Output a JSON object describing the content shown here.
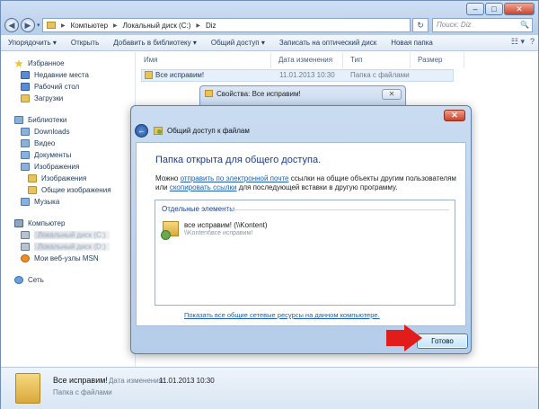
{
  "window": {
    "min_glyph": "–",
    "max_glyph": "□",
    "close_glyph": "✕"
  },
  "address_bar": {
    "crumbs": [
      "Компьютер",
      "Локальный диск (C:)",
      "Diz"
    ],
    "refresh_glyph": "↻"
  },
  "search": {
    "placeholder": "Поиск: Diz",
    "icon_glyph": "🔍"
  },
  "toolbar": {
    "organize": "Упорядочить ▾",
    "open": "Открыть",
    "add_to_library": "Добавить в библиотеку ▾",
    "share": "Общий доступ ▾",
    "burn": "Записать на оптический диск",
    "new_folder": "Новая папка",
    "view_glyph": "☷ ▾",
    "help_glyph": "?"
  },
  "sidebar": {
    "favorites": "Избранное",
    "recent": "Недавние места",
    "desktop": "Рабочий стол",
    "downloads": "Загрузки",
    "libraries": "Библиотеки",
    "lib_downloads": "Downloads",
    "video": "Видео",
    "documents": "Документы",
    "images": "Изображения",
    "images_sub": "Изображения",
    "public_images": "Общие изображения",
    "music": "Музыка",
    "computer": "Компьютер",
    "drive_c": "Локальный диск (C:)",
    "drive_d": "Локальный диск (D:)",
    "msn": "Мои веб-узлы MSN",
    "network": "Сеть"
  },
  "file_list": {
    "columns": [
      "Имя",
      "Дата изменения",
      "Тип",
      "Размер"
    ],
    "rows": [
      {
        "name": "Все исправим!",
        "date": "11.01.2013 10:30",
        "type": "Папка с файлами",
        "size": ""
      }
    ]
  },
  "details_pane": {
    "name": "Все исправим!",
    "date_label": "Дата изменения:",
    "date": "11.01.2013 10:30",
    "type": "Папка с файлами"
  },
  "properties_window": {
    "title": "Свойства: Все исправим!",
    "close_glyph": "✕"
  },
  "share_dialog": {
    "title": "Общий доступ к файлам",
    "close_glyph": "✕",
    "back_glyph": "←",
    "heading": "Папка открыта для общего доступа.",
    "text_prefix": "Можно",
    "link_email": "отправить по электронной почте",
    "text_mid": "ссылки на общие объекты другим пользователям или",
    "link_copy": "скопировать ссылки",
    "text_suffix": "для последующей вставки в другую программу.",
    "group_header": "Отдельные элементы",
    "item_name": "все исправим! (\\\\Kontent)",
    "item_path": "\\\\Kontent\\все исправим!",
    "show_all_link": "Показать все общие сетевые ресурсы на данном компьютере.",
    "done_button": "Готово"
  },
  "colors": {
    "accent_red": "#e21b1b",
    "link_blue": "#1c5fb0",
    "heading_blue": "#1b3e8c"
  }
}
